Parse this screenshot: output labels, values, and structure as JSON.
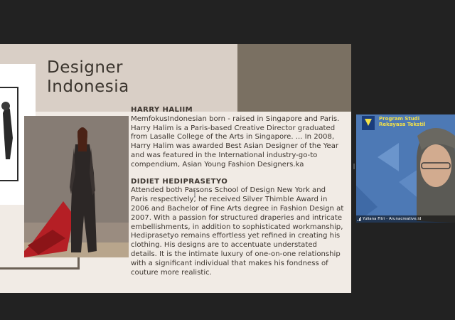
{
  "slide": {
    "title_line1": "Designer",
    "title_line2": "Indonesia",
    "designers": [
      {
        "name": "HARRY HALIIM",
        "bio": "MemfokusIndonesian born - raised in Singapore and Paris. Harry Halim is a Paris-based Creative Director graduated from Lasalle College of the Arts in Singapore. ... In 2008, Harry Halim was awarded Best Asian Designer of the Year and was featured in the International industry-go-to compendium, Asian Young Fashion Designers.ka"
      },
      {
        "name": "DIDIET HEDIPRASETYO",
        "bio": "Attended both Parsons School of Design New York and Paris respectively, he received Silver Thimble Award in 2006 and Bachelor of Fine Arts degree in Fashion Design at 2007. With a passion for structured draperies and intricate embellishments, in addition to sophisticated workmanship, Hediprasetyo remains effortless yet refined in creating his clothing. His designs are to accentuate understated details. It is the intimate luxury of one-on-one relationship with a significant individual that makes his fondness of couture more realistic."
      }
    ]
  },
  "participant": {
    "name": "Yuliana Fitri - Arunacreative.id",
    "logo_line1": "Program Studi",
    "logo_line2": "Rekayasa Tekstil"
  },
  "colors": {
    "background": "#222222",
    "slide": "#f1ebe5",
    "tan": "#d9cfc6",
    "olive": "#7a7062",
    "video_bg": "#4d79b5"
  }
}
